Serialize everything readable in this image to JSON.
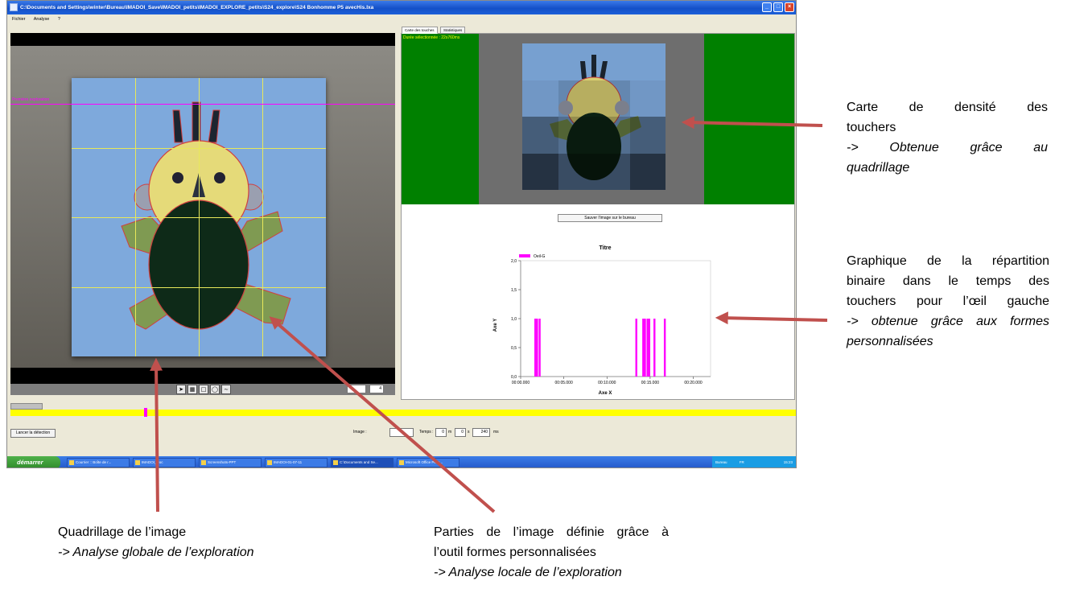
{
  "window": {
    "title": "C:\\Documents and Settings\\winter\\Bureau\\IMADOI_Save\\IMADOI_petits\\IMADOI_EXPLORE_petits\\S24_explore\\S24 Bonhomme P5 avecHis.Ixa"
  },
  "menu": {
    "items": [
      "Fichier",
      "Analyse",
      "?"
    ]
  },
  "video": {
    "first_exploration_label": "Première exploration"
  },
  "tabs": {
    "tab1": "Carte des touches",
    "tab2": "Statistiques"
  },
  "density": {
    "duration_label": "Durée sélectionnée : 22s760ms"
  },
  "buttons": {
    "save_image": "Sauver l'image sur le bureau",
    "start_detection": "Lancer la détection"
  },
  "controls": {
    "image_label": "Image :",
    "time_label": "Temps :",
    "min_value": "0",
    "min_unit": "m",
    "sec_value": "0",
    "sec_unit": "s",
    "ms_value": "240",
    "ms_unit": "ms",
    "spinner_value": "4"
  },
  "chart_data": {
    "type": "bar",
    "title": "Titre",
    "xlabel": "Axe X",
    "ylabel": "Axe Y",
    "legend": {
      "entries": [
        "Oeil-G"
      ],
      "placement": "top-left"
    },
    "series": [
      {
        "name": "Oeil-G",
        "color": "#ff00ff",
        "x_seconds": [
          1.7,
          1.9,
          2.2,
          13.4,
          14.2,
          14.4,
          14.7,
          14.9,
          15.5,
          16.7
        ],
        "y": [
          1,
          1,
          1,
          1,
          1,
          1,
          1,
          1,
          1,
          1
        ]
      }
    ],
    "xlim": [
      0,
      22
    ],
    "ylim": [
      0,
      2
    ],
    "x_ticks": [
      "00:00.000",
      "00:05.000",
      "00:10.000",
      "00:15.000",
      "00:20.000"
    ],
    "x_tick_values": [
      0,
      5,
      10,
      15,
      20
    ],
    "y_ticks": [
      "0,0",
      "0,5",
      "1,0",
      "1,5",
      "2,0"
    ],
    "y_tick_values": [
      0,
      0.5,
      1,
      1.5,
      2
    ]
  },
  "taskbar": {
    "start_label": "démarrer",
    "items": [
      "Courrier :: Boîte de r...",
      "IMADOI_Doc",
      "Screenshots-PPT",
      "IMADOI-01-07-11",
      "C:\\Documents and Se...",
      "Microsoft Office Pictu..."
    ],
    "tray_text": "Bureau",
    "tray_lang": "FR",
    "clock": "15:23"
  },
  "annotations": {
    "density_map": {
      "line1": "Carte de densité des",
      "line2": "touchers",
      "line3": "-> Obtenue grâce au",
      "line4": "quadrillage"
    },
    "binary_chart": {
      "line1": "Graphique de la répartition",
      "line2": "binaire dans le temps des",
      "line3": "touchers pour l’œil gauche",
      "line4": "-> obtenue grâce aux formes",
      "line5": "personnalisées"
    },
    "grid": {
      "line1": "Quadrillage de l’image",
      "line2": "-> Analyse globale de l’exploration"
    },
    "custom_shapes": {
      "line1": "Parties de l’image définie grâce à",
      "line2": "l’outil formes personnalisées",
      "line3": "-> Analyse locale de l’exploration"
    }
  },
  "colors": {
    "arrow": "#c0504d",
    "density_background": "#008000",
    "series": "#ff00ff",
    "timeline": "#ffff00"
  }
}
